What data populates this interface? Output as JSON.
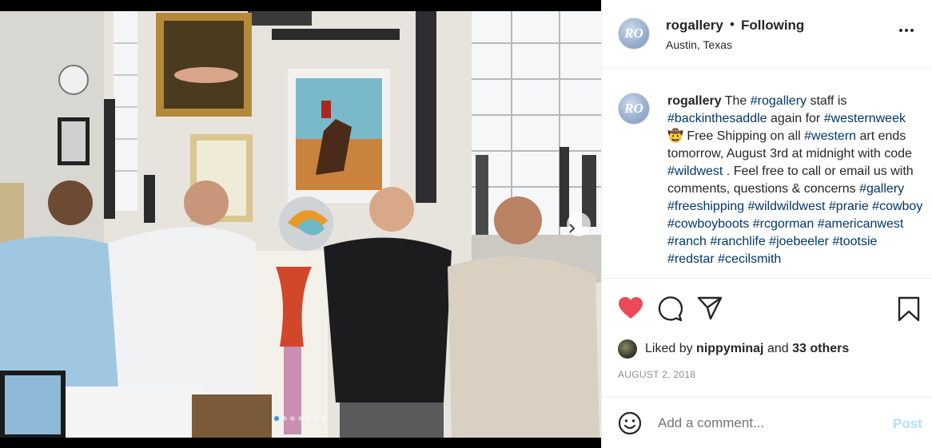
{
  "colors": {
    "heart": "#ed4956",
    "hashtag": "#00376b",
    "muted": "#8e8e8e",
    "post_disabled": "#b2dffc",
    "active_dot": "#3797f0"
  },
  "post": {
    "avatar_initials": "RO",
    "header": {
      "username": "rogallery",
      "separator": "•",
      "follow_status": "Following",
      "location": "Austin, Texas"
    },
    "caption": {
      "username": "rogallery",
      "segments": [
        {
          "t": "text",
          "v": "The "
        },
        {
          "t": "tag",
          "v": "#rogallery"
        },
        {
          "t": "text",
          "v": " staff is "
        },
        {
          "t": "tag",
          "v": "#backinthesaddle"
        },
        {
          "t": "text",
          "v": " again for "
        },
        {
          "t": "tag",
          "v": "#westernweek"
        },
        {
          "t": "text",
          "v": " 🤠 Free Shipping on all "
        },
        {
          "t": "tag",
          "v": "#western"
        },
        {
          "t": "text",
          "v": " art ends tomorrow, August 3rd at midnight with code "
        },
        {
          "t": "tag",
          "v": "#wildwest"
        },
        {
          "t": "text",
          "v": " . Feel free to call or email us with comments, questions & concerns "
        },
        {
          "t": "tag",
          "v": "#gallery"
        },
        {
          "t": "text",
          "v": " "
        },
        {
          "t": "tag",
          "v": "#freeshipping"
        },
        {
          "t": "text",
          "v": " "
        },
        {
          "t": "tag",
          "v": "#wildwildwest"
        },
        {
          "t": "text",
          "v": " "
        },
        {
          "t": "tag",
          "v": "#prarie"
        },
        {
          "t": "text",
          "v": " "
        },
        {
          "t": "tag",
          "v": "#cowboy"
        },
        {
          "t": "text",
          "v": " "
        },
        {
          "t": "tag",
          "v": "#cowboyboots"
        },
        {
          "t": "text",
          "v": " "
        },
        {
          "t": "tag",
          "v": "#rcgorman"
        },
        {
          "t": "text",
          "v": " "
        },
        {
          "t": "tag",
          "v": "#americanwest"
        },
        {
          "t": "text",
          "v": " "
        },
        {
          "t": "tag",
          "v": "#ranch"
        },
        {
          "t": "text",
          "v": " "
        },
        {
          "t": "tag",
          "v": "#ranchlife"
        },
        {
          "t": "text",
          "v": " "
        },
        {
          "t": "tag",
          "v": "#joebeeler"
        },
        {
          "t": "text",
          "v": " "
        },
        {
          "t": "tag",
          "v": "#tootsie"
        },
        {
          "t": "text",
          "v": " "
        },
        {
          "t": "tag",
          "v": "#redstar"
        },
        {
          "t": "text",
          "v": " "
        },
        {
          "t": "tag",
          "v": "#cecilsmith"
        }
      ]
    },
    "actions": {
      "like_icon": "heart-filled-icon",
      "comment_icon": "comment-icon",
      "share_icon": "share-icon",
      "save_icon": "bookmark-icon"
    },
    "likes": {
      "prefix": "Liked by ",
      "user": "nippyminaj",
      "middle": " and ",
      "others": "33 others"
    },
    "date": "AUGUST 2, 2018",
    "add_comment": {
      "placeholder": "Add a comment...",
      "post_label": "Post"
    },
    "carousel": {
      "slide_count": 7,
      "active_index": 0
    }
  }
}
